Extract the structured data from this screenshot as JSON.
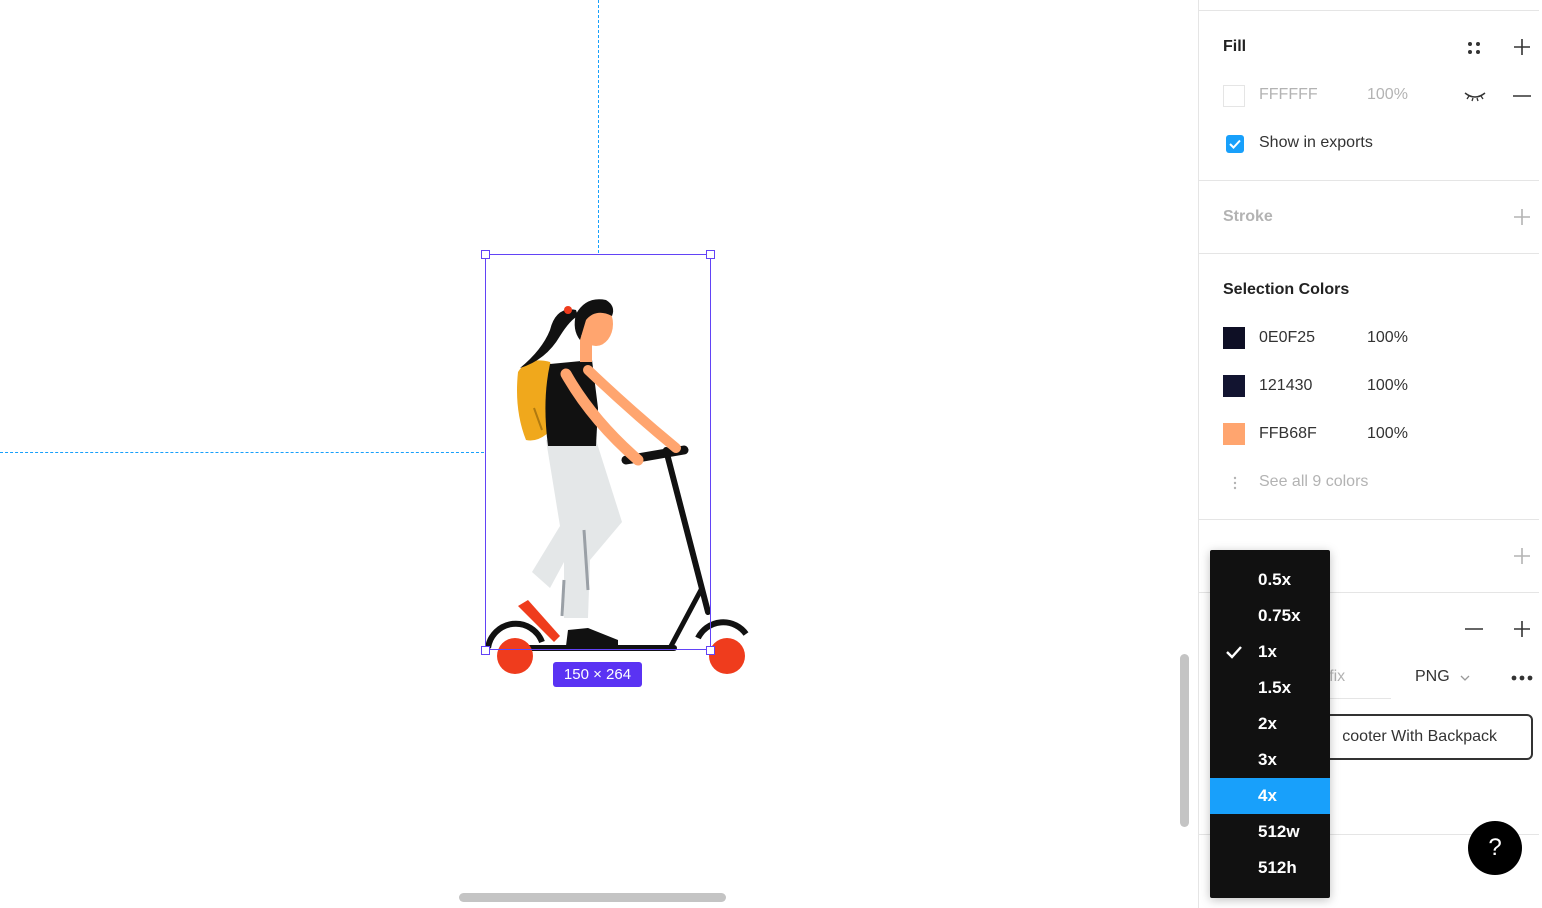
{
  "canvas": {
    "selection_size": "150 × 264"
  },
  "panel": {
    "fill": {
      "title": "Fill",
      "color_hex": "FFFFFF",
      "opacity": "100%",
      "show_in_exports": "Show in exports"
    },
    "stroke": {
      "title": "Stroke"
    },
    "selection_colors": {
      "title": "Selection Colors",
      "items": [
        {
          "hex": "0E0F25",
          "opacity": "100%",
          "swatch": "#0e0f25"
        },
        {
          "hex": "121430",
          "opacity": "100%",
          "swatch": "#121430"
        },
        {
          "hex": "FFB68F",
          "opacity": "100%",
          "swatch": "#ffa56f"
        }
      ],
      "see_all": "See all 9 colors"
    },
    "export": {
      "suffix_placeholder": "ffix",
      "format": "PNG",
      "button_label": "cooter With Backpack"
    },
    "help": "?"
  },
  "scale_menu": {
    "items": [
      "0.5x",
      "0.75x",
      "1x",
      "1.5x",
      "2x",
      "3x",
      "4x",
      "512w",
      "512h"
    ],
    "checked": "1x",
    "highlighted": "4x"
  },
  "colors": {
    "accent": "#18a0fb",
    "selection": "#6243f6",
    "badge": "#5a33f3"
  }
}
